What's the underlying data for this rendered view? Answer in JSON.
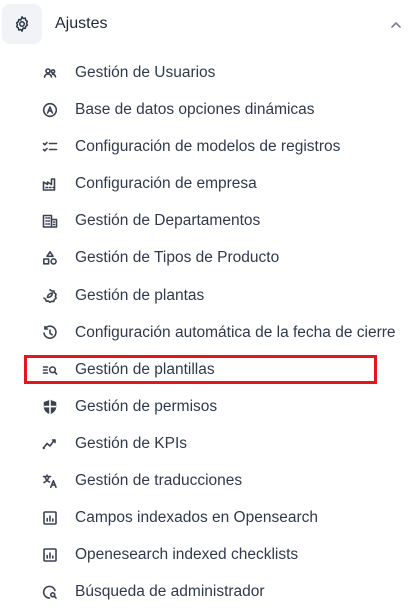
{
  "header": {
    "title": "Ajustes",
    "icon": "gear-icon",
    "chevron": "chevron-up-icon"
  },
  "menu": {
    "items": [
      {
        "label": "Gestión de Usuarios",
        "icon": "users-icon"
      },
      {
        "label": "Base de datos opciones dinámicas",
        "icon": "circle-a-icon"
      },
      {
        "label": "Configuración de modelos de registros",
        "icon": "checklist-icon"
      },
      {
        "label": "Configuración de empresa",
        "icon": "factory-icon"
      },
      {
        "label": "Gestión de Departamentos",
        "icon": "building-icon"
      },
      {
        "label": "Gestión de Tipos de Producto",
        "icon": "shapes-icon"
      },
      {
        "label": "Gestión de plantas",
        "icon": "leaf-badge-icon"
      },
      {
        "label": "Configuración automática de la fecha de cierre",
        "icon": "clock-refresh-icon"
      },
      {
        "label": "Gestión de plantillas",
        "icon": "list-search-icon"
      },
      {
        "label": "Gestión de permisos",
        "icon": "shield-icon"
      },
      {
        "label": "Gestión de KPIs",
        "icon": "trend-icon"
      },
      {
        "label": "Gestión de traducciones",
        "icon": "translate-icon"
      },
      {
        "label": "Campos indexados en Opensearch",
        "icon": "chart-box-icon"
      },
      {
        "label": "Openesearch indexed checklists",
        "icon": "chart-box-icon"
      },
      {
        "label": "Búsqueda de administrador",
        "icon": "search-badge-icon"
      }
    ]
  },
  "highlight_color": "#e3161b"
}
